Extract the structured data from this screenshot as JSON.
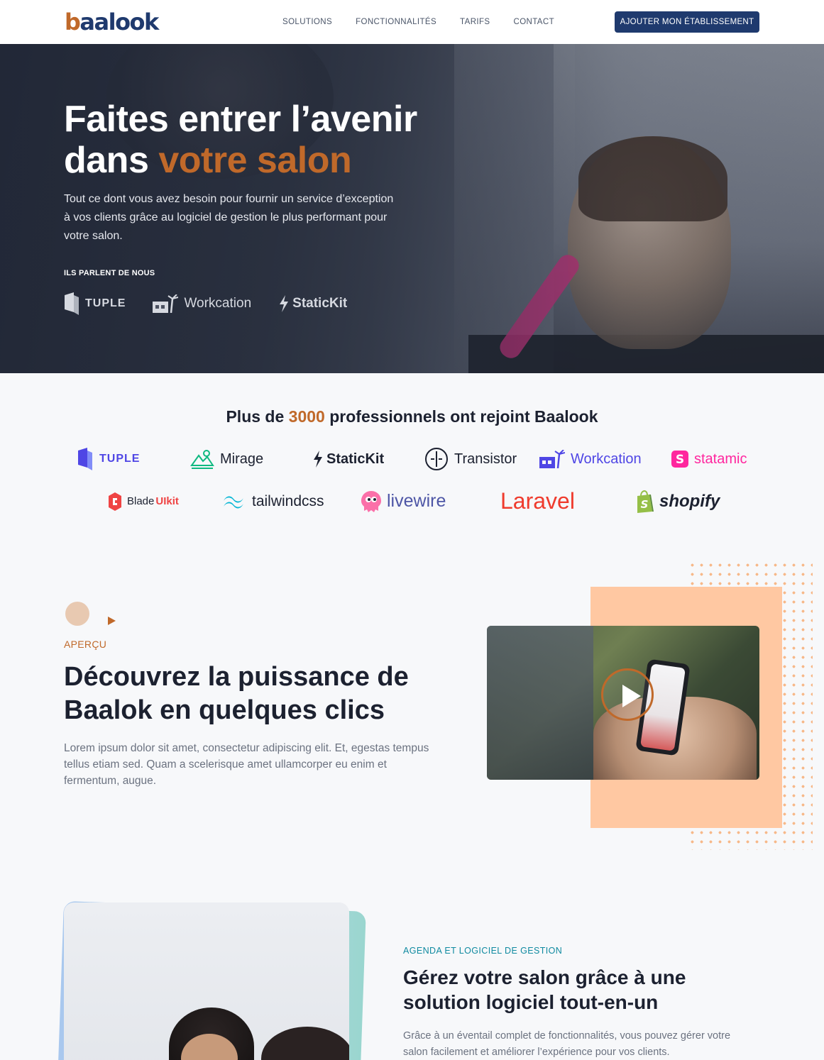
{
  "nav": {
    "logo": "baalook",
    "links": [
      "SOLUTIONS",
      "FONCTIONNALITÉS",
      "TARIFS",
      "CONTACT"
    ],
    "cta": "AJOUTER MON ÉTABLISSEMENT"
  },
  "hero": {
    "title_line1": "Faites entrer l’avenir",
    "title_line2_prefix": "dans ",
    "title_accent": "votre salon",
    "subtitle": "Tout ce dont vous avez besoin pour fournir un service d’exception à vos clients grâce au logiciel de gestion le plus performant pour votre salon.",
    "press_label": "ILS PARLENT DE NOUS",
    "press_logos": [
      "TUPLE",
      "Workcation",
      "StaticKit"
    ]
  },
  "clients": {
    "title_prefix": "Plus de ",
    "title_number": "3000",
    "title_suffix": " professionnels ont rejoint Baalook",
    "row1": [
      "TUPLE",
      "Mirage",
      "StaticKit",
      "Transistor",
      "Workcation",
      "statamic"
    ],
    "row2": [
      "Blade",
      "UIkit",
      "tailwindcss",
      "livewire",
      "Laravel",
      "shopify"
    ]
  },
  "overview": {
    "eyebrow": "APERÇU",
    "title": "Découvrez la puissance de Baalok en quelques clics",
    "text": "Lorem ipsum dolor sit amet, consectetur adipiscing elit. Et, egestas tempus tellus etiam sed. Quam a scelerisque amet ullamcorper eu enim et fermentum, augue."
  },
  "agenda": {
    "eyebrow": "AGENDA ET LOGICIEL DE GESTION",
    "title": "Gérez votre salon grâce à une solution logiciel tout-en-un",
    "text": "Grâce à un éventail complet de fonctionnalités, vous pouvez gérer votre salon facilement et améliorer l’expérience pour vos clients."
  },
  "colors": {
    "brand_navy": "#1f3a6e",
    "accent_orange": "#c0692a",
    "teal": "#0f8aa0",
    "peach": "#ffc8a2"
  }
}
